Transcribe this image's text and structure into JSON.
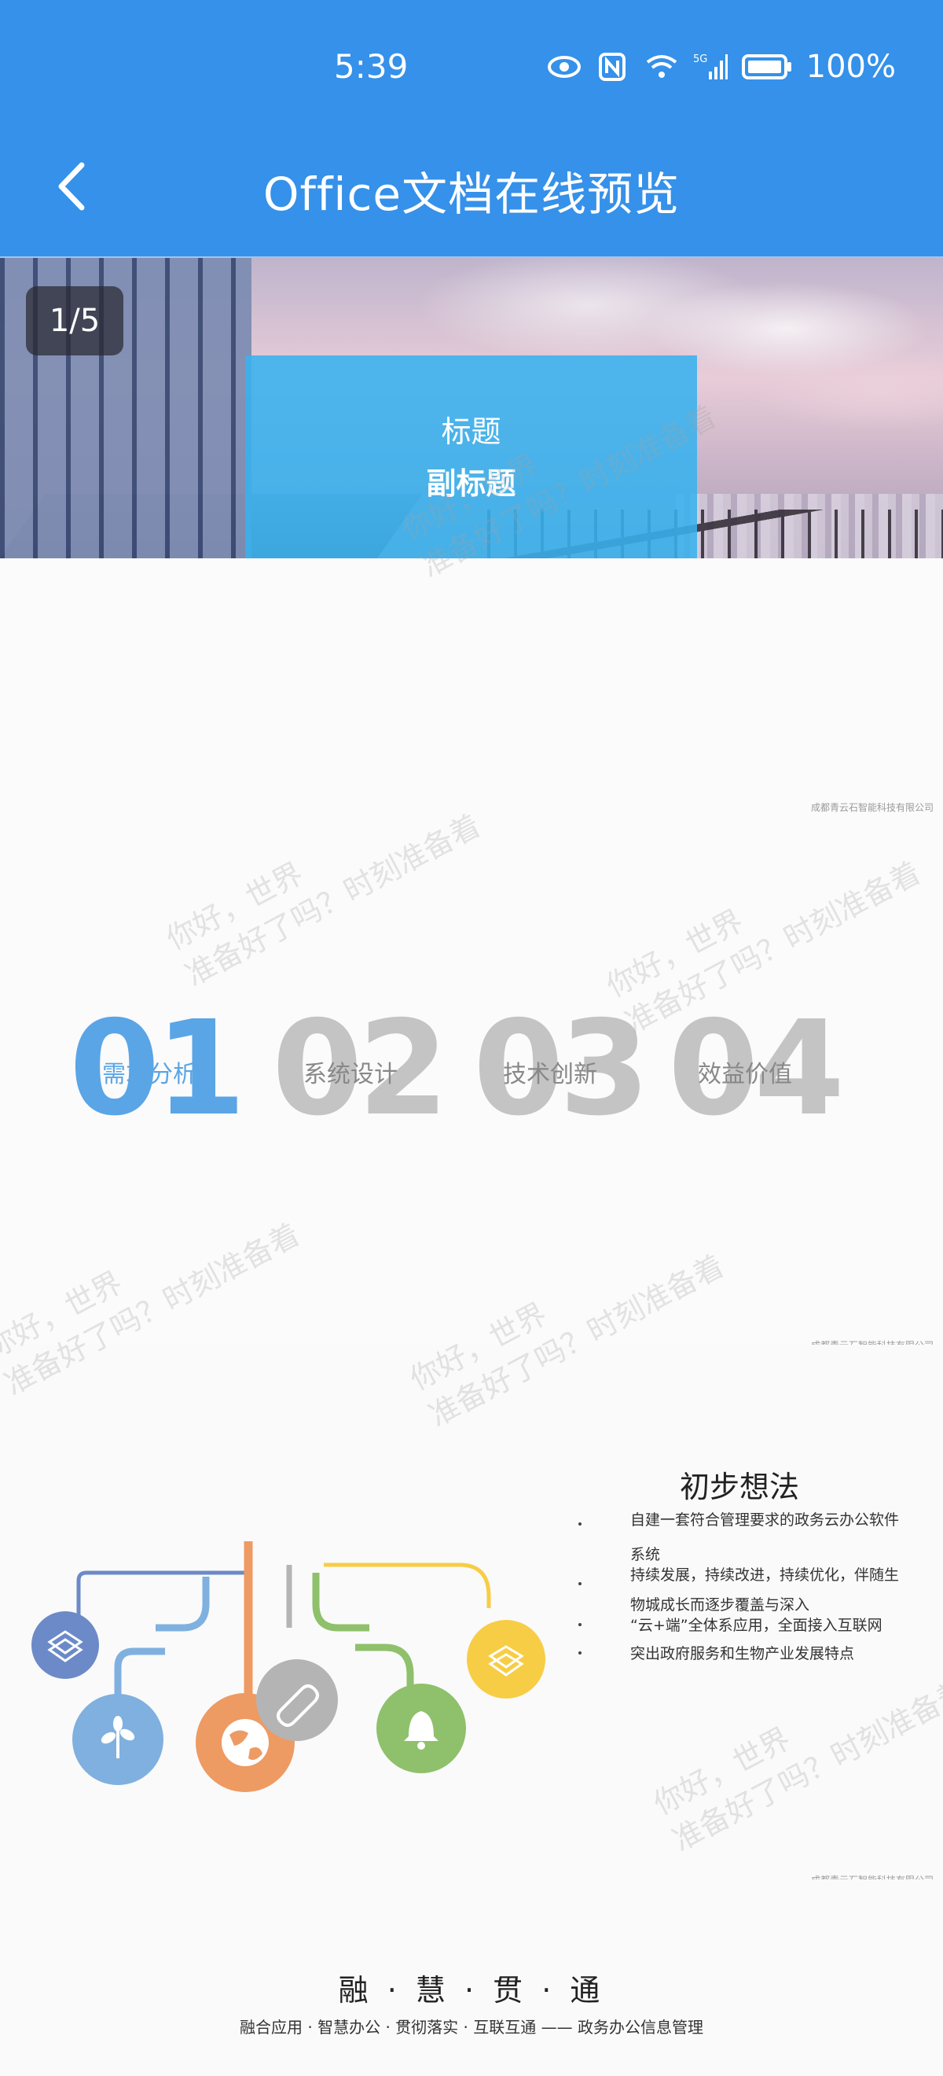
{
  "status_bar": {
    "time": "5:39",
    "battery": "100%",
    "icons": [
      "eye-icon",
      "nfc-icon",
      "wifi-icon",
      "signal-5g-icon",
      "battery-icon"
    ]
  },
  "app_bar": {
    "title": "Office文档在线预览",
    "back_icon": "chevron-left-icon"
  },
  "slide1": {
    "page_counter": "1/5",
    "title": "标题",
    "subtitle": "副标题"
  },
  "slide2": {
    "company": "成都青云石智能科技有限公司",
    "steps": [
      {
        "num": "01",
        "label": "需求分析",
        "color": "#5aa5e6"
      },
      {
        "num": "02",
        "label": "系统设计",
        "color": "#c4c4c4"
      },
      {
        "num": "03",
        "label": "技术创新",
        "color": "#c4c4c4"
      },
      {
        "num": "04",
        "label": "效益价值",
        "color": "#c4c4c4"
      }
    ]
  },
  "slide3": {
    "company": "成都青云石智能科技有限公司",
    "title": "初步想法",
    "bullets": [
      "自建一套符合管理要求的政务云办公软件",
      "系统",
      "持续发展，持续改进，持续优化，伴随生",
      "物城成长而逐步覆盖与深入",
      "“云+端”全体系应用，全面接入互联网",
      "突出政府服务和生物产业发展特点"
    ],
    "icons": [
      "codepen-icon",
      "codepen-icon",
      "leaf-icon",
      "globe-icon",
      "paperclip-icon",
      "bell-icon"
    ],
    "colors": {
      "blue": "#6c8ac7",
      "light_blue": "#7fb0df",
      "orange": "#ee9a63",
      "gray": "#b4b4b4",
      "green": "#8fc06b",
      "yellow": "#f7cd45"
    }
  },
  "slide3_company": "成都青云石智能科技有限公司",
  "slide4": {
    "title": "融 · 慧 · 贯 · 通",
    "subtitle": "融合应用 · 智慧办公 · 贯彻落实 · 互联互通 —— 政务办公信息管理"
  },
  "watermark": {
    "line1": "你好，世界",
    "line2": "准备好了吗？时刻准备着"
  }
}
